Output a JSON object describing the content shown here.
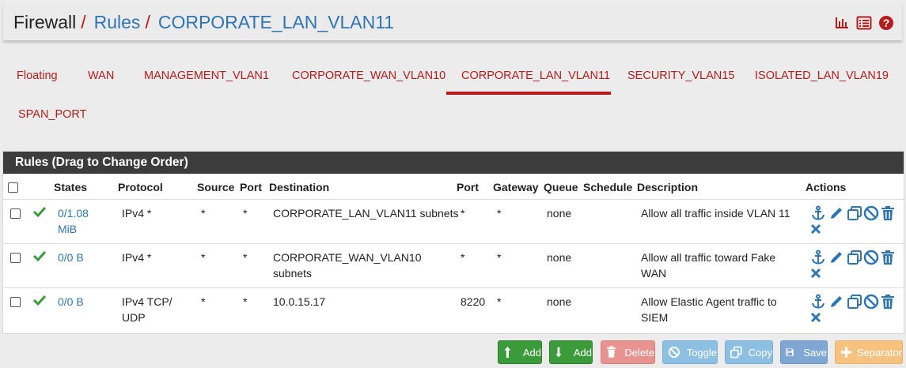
{
  "breadcrumb": {
    "home": "Firewall",
    "separator": "/",
    "rules": "Rules",
    "current": "CORPORATE_LAN_VLAN11"
  },
  "header_icons": [
    "chart-icon",
    "list-icon",
    "help-icon"
  ],
  "tabs": [
    {
      "label": "Floating",
      "active": false
    },
    {
      "label": "WAN",
      "active": false
    },
    {
      "label": "MANAGEMENT_VLAN1",
      "active": false
    },
    {
      "label": "CORPORATE_WAN_VLAN10",
      "active": false
    },
    {
      "label": "CORPORATE_LAN_VLAN11",
      "active": true
    },
    {
      "label": "SECURITY_VLAN15",
      "active": false
    },
    {
      "label": "ISOLATED_LAN_VLAN19",
      "active": false
    },
    {
      "label": "SPAN_PORT",
      "active": false
    }
  ],
  "panel": {
    "title": "Rules (Drag to Change Order)"
  },
  "columns": [
    "States",
    "Protocol",
    "Source",
    "Port",
    "Destination",
    "Port",
    "Gateway",
    "Queue",
    "Schedule",
    "Description",
    "Actions"
  ],
  "rows": [
    {
      "states": "0/1.08 MiB",
      "protocol": "IPv4 *",
      "source": "*",
      "port": "*",
      "destination": "CORPORATE_LAN_VLAN11 subnets",
      "dport": "*",
      "gateway": "*",
      "queue": "none",
      "schedule": "",
      "description": "Allow all traffic inside VLAN 11"
    },
    {
      "states": "0/0 B",
      "protocol": "IPv4 *",
      "source": "*",
      "port": "*",
      "destination": "CORPORATE_WAN_VLAN10 subnets",
      "dport": "*",
      "gateway": "*",
      "queue": "none",
      "schedule": "",
      "description": "Allow all traffic toward Fake WAN"
    },
    {
      "states": "0/0 B",
      "protocol": "IPv4 TCP/ UDP",
      "source": "*",
      "port": "*",
      "destination": "10.0.15.17",
      "dport": "8220",
      "gateway": "*",
      "queue": "none",
      "schedule": "",
      "description": "Allow Elastic Agent traffic to SIEM"
    }
  ],
  "buttons": {
    "add_top": "Add",
    "add_bottom": "Add",
    "delete": "Delete",
    "toggle": "Toggle",
    "copy": "Copy",
    "save": "Save",
    "separator": "Separator"
  },
  "colors": {
    "accent_red": "#b71c1c",
    "link_blue": "#2e75b6",
    "check_green": "#3a9b3a",
    "btn_green": "#3b9b3b",
    "btn_red": "#d9534f",
    "btn_blue": "#5bc0de",
    "btn_primary": "#3572b0",
    "btn_orange": "#f0ad4e"
  }
}
